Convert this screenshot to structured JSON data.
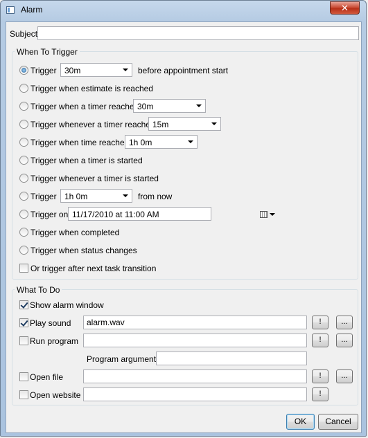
{
  "window": {
    "title": "Alarm",
    "close_glyph": "✕",
    "icons": {
      "app": "alarm-app-icon",
      "close": "close-icon"
    }
  },
  "subject": {
    "label": "Subject",
    "value": ""
  },
  "trigger_group": {
    "title": "When To Trigger",
    "options": [
      {
        "label": "Trigger",
        "checked": true,
        "combo": "30m",
        "suffix": "before appointment start"
      },
      {
        "label": "Trigger when estimate is reached",
        "checked": false
      },
      {
        "label": "Trigger when a timer reaches",
        "checked": false,
        "combo": "30m"
      },
      {
        "label": "Trigger whenever a timer reaches",
        "checked": false,
        "combo": "15m"
      },
      {
        "label": "Trigger when time reaches",
        "checked": false,
        "combo": "1h 0m"
      },
      {
        "label": "Trigger when a timer is started",
        "checked": false
      },
      {
        "label": "Trigger whenever a timer is started",
        "checked": false
      },
      {
        "label": "Trigger",
        "checked": false,
        "combo": "1h 0m",
        "suffix": "from now"
      },
      {
        "label": "Trigger on",
        "checked": false,
        "date": "11/17/2010 at 11:00 AM"
      },
      {
        "label": "Trigger when completed",
        "checked": false
      },
      {
        "label": "Trigger when status changes",
        "checked": false
      }
    ],
    "after_transition": {
      "label": "Or trigger after next task transition",
      "checked": false
    }
  },
  "action_group": {
    "title": "What To Do",
    "show_window": {
      "label": "Show alarm window",
      "checked": true
    },
    "play_sound": {
      "label": "Play sound",
      "checked": true,
      "value": "alarm.wav"
    },
    "run_program": {
      "label": "Run program",
      "checked": false,
      "value": ""
    },
    "program_arguments": {
      "label": "Program arguments",
      "value": ""
    },
    "open_file": {
      "label": "Open file",
      "checked": false,
      "value": ""
    },
    "open_website": {
      "label": "Open website",
      "checked": false,
      "value": ""
    },
    "test_label": "!",
    "browse_label": "..."
  },
  "buttons": {
    "ok": "OK",
    "cancel": "Cancel"
  }
}
